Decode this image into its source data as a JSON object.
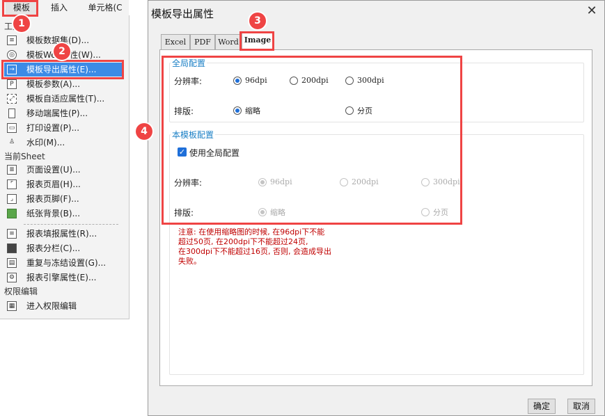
{
  "menubar": {
    "tabs": [
      "模板",
      "插入",
      "单元格(C"
    ]
  },
  "menu": {
    "group1_label": "工具",
    "group2_label": "当前Sheet",
    "group3_label": "权限编辑",
    "items": [
      {
        "label": "模板数据集(D)...",
        "icon": "database-icon"
      },
      {
        "label": "模板Web属性(W)...",
        "icon": "globe-icon"
      },
      {
        "label": "模板导出属性(E)...",
        "icon": "export-icon"
      },
      {
        "label": "模板参数(A)...",
        "icon": "parameter-icon"
      },
      {
        "label": "模板自适应属性(T)...",
        "icon": "adaptive-icon"
      },
      {
        "label": "移动端属性(P)...",
        "icon": "mobile-icon"
      },
      {
        "label": "打印设置(P)...",
        "icon": "printer-icon"
      },
      {
        "label": "水印(M)...",
        "icon": "watermark-icon"
      },
      {
        "label": "页面设置(U)...",
        "icon": "page-setup-icon"
      },
      {
        "label": "报表页眉(H)...",
        "icon": "header-icon"
      },
      {
        "label": "报表页脚(F)...",
        "icon": "footer-icon"
      },
      {
        "label": "纸张背景(B)...",
        "icon": "background-icon"
      },
      {
        "label": "报表填报属性(R)...",
        "icon": "fill-icon"
      },
      {
        "label": "报表分栏(C)...",
        "icon": "columns-icon"
      },
      {
        "label": "重复与冻结设置(G)...",
        "icon": "freeze-icon"
      },
      {
        "label": "报表引擎属性(E)...",
        "icon": "engine-icon"
      },
      {
        "label": "进入权限编辑",
        "icon": "permission-icon"
      }
    ]
  },
  "badges": [
    "1",
    "2",
    "3",
    "4"
  ],
  "dialog": {
    "title": "模板导出属性",
    "close": "✕",
    "tabs": [
      "Excel",
      "PDF",
      "Word",
      "Image"
    ],
    "active_tab": "Image",
    "global": {
      "title": "全局配置",
      "resolution_label": "分辨率:",
      "resolution_options": [
        "96dpi",
        "200dpi",
        "300dpi"
      ],
      "resolution_selected": "96dpi",
      "layout_label": "排版:",
      "layout_options": [
        "缩略",
        "分页"
      ],
      "layout_selected": "缩略"
    },
    "template": {
      "title": "本模板配置",
      "use_global_label": "使用全局配置",
      "use_global_checked": true,
      "resolution_label": "分辨率:",
      "resolution_options": [
        "96dpi",
        "200dpi",
        "300dpi"
      ],
      "layout_label": "排版:",
      "layout_options": [
        "缩略",
        "分页"
      ]
    },
    "note_lines": [
      "注意: 在使用缩略图的时候, 在96dpi下不能",
      "超过50页, 在200dpi下不能超过24页,",
      "在300dpi下不能超过16页, 否则, 会造成导出",
      "失败。"
    ],
    "ok_label": "确定",
    "cancel_label": "取消"
  },
  "colors": {
    "accent": "#3c8be6",
    "annotation": "#ef4444",
    "note": "#c00000",
    "section_title": "#1a7fc5"
  }
}
